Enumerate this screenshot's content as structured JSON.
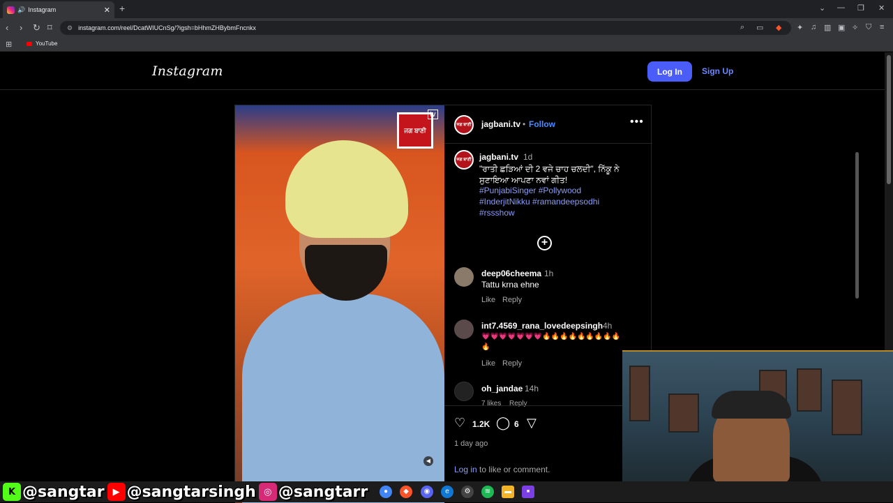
{
  "browser": {
    "tab_title": "Instagram",
    "new_tab": "+",
    "tab_close": "✕",
    "url": "instagram.com/reel/DcatWIUCnSg/?igsh=bHhmZHBybmFncnkx",
    "bookmark_youtube": "YouTube"
  },
  "header": {
    "logo": "Instagram",
    "login_label": "Log In",
    "signup_label": "Sign Up"
  },
  "post": {
    "channel_logo_text": "ਜਗ ਬਾਣੀ",
    "tv_text": "tv",
    "username": "jagbani.tv",
    "separator": "•",
    "follow_label": "Follow",
    "more_label": "•••",
    "caption": {
      "username": "jagbani.tv",
      "time": "1d",
      "text": "\"ਰਾਤੀ ਛੜਿਆਂ ਦੀ 2 ਵਜੇ ਚਾਹ ਚਲਦੀ\", ਨਿੱਕੂ ਨੇ ਸੁਣਾਇਆ ਆਪਣਾ ਨਵਾਂ ਗੀਤ!",
      "hashtags": [
        "#PunjabiSinger",
        "#Pollywood",
        "#InderjitNikku",
        "#ramandeepsodhi",
        "#rssshow"
      ]
    },
    "comments": [
      {
        "username": "deep06cheema",
        "time": "1h",
        "text": "Tattu krna ehne",
        "like": "Like",
        "reply": "Reply"
      },
      {
        "username": "int7.4569_rana_lovedeepsingh",
        "time": "4h",
        "text": "💗💗💗💗💗💗💗🔥🔥🔥🔥🔥🔥🔥🔥🔥🔥",
        "like": "Like",
        "reply": "Reply"
      },
      {
        "username": "oh_jandae",
        "time": "14h",
        "text": "",
        "like": "7 likes",
        "reply": "Reply"
      }
    ],
    "likes_count": "1.2K",
    "comments_count": "6",
    "posted_ago": "1 day ago",
    "login_prompt_link": "Log in",
    "login_prompt_rest": " to like or comment."
  },
  "overlay": {
    "socials": [
      {
        "icon": "K",
        "handle": "@sangtar",
        "color": "#53fc18"
      },
      {
        "icon": "▶",
        "handle": "@sangtarsingh",
        "color": "#ff0000"
      },
      {
        "icon": "◎",
        "handle": "@sangtarr",
        "color": "#d62976"
      }
    ]
  },
  "colors": {
    "accent_blue": "#4a5df9",
    "link_blue": "#8c9df7",
    "follow_blue": "#4a8cff"
  }
}
